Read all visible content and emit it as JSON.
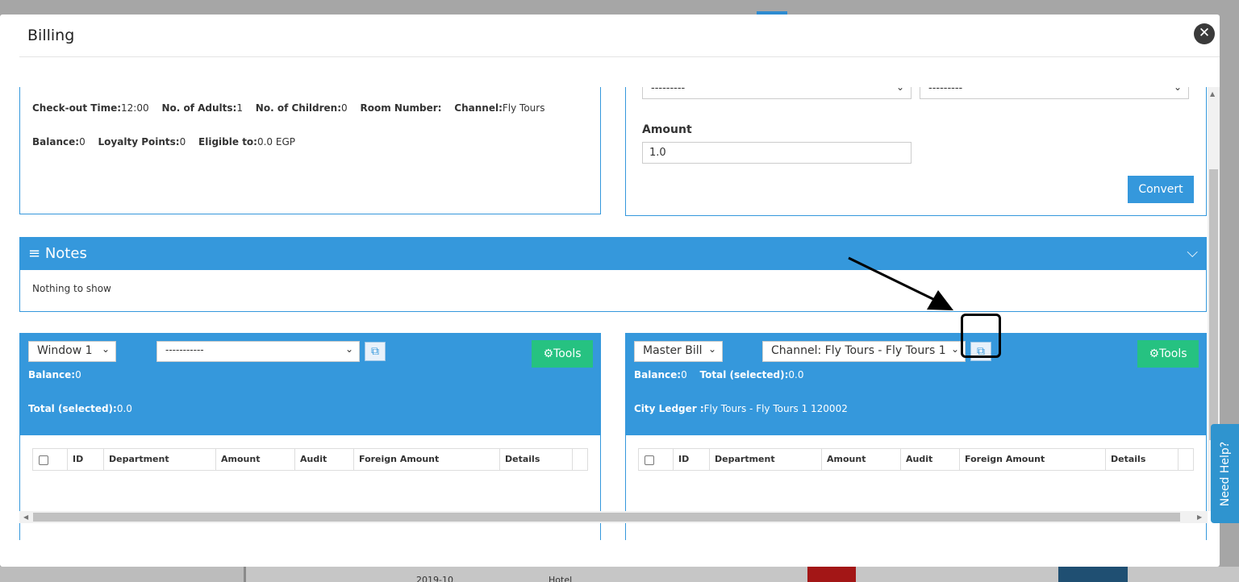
{
  "modal": {
    "title": "Billing"
  },
  "info": {
    "row1": [
      {
        "label": "Check-out Time:",
        "value": "12:00"
      },
      {
        "label": "No. of Adults:",
        "value": "1"
      },
      {
        "label": "No. of Children:",
        "value": "0"
      },
      {
        "label": "Room Number:",
        "value": ""
      },
      {
        "label": "Channel:",
        "value": "Fly Tours"
      }
    ],
    "row2": [
      {
        "label": "Balance:",
        "value": "0"
      },
      {
        "label": "Loyalty Points:",
        "value": "0"
      },
      {
        "label": "Eligible to:",
        "value": "0.0 EGP"
      }
    ]
  },
  "convert": {
    "select1": "---------",
    "select2": "---------",
    "amount_label": "Amount",
    "amount_value": "1.0",
    "button": "Convert"
  },
  "notes": {
    "title": "Notes",
    "body": "Nothing to show"
  },
  "window_left": {
    "window_select": "Window 1",
    "target_select": "-----------",
    "tools": "Tools",
    "balance_label": "Balance:",
    "balance_value": "0",
    "total_label": "Total (selected):",
    "total_value": "0.0"
  },
  "window_right": {
    "window_select": "Master Bill",
    "target_select": "Channel: Fly Tours - Fly Tours 1",
    "tools": "Tools",
    "balance_label": "Balance:",
    "balance_value": "0",
    "total_label": "Total (selected):",
    "total_value": "0.0",
    "ledger_label": "City Ledger :",
    "ledger_value": "Fly Tours - Fly Tours 1 120002"
  },
  "table_columns": [
    "ID",
    "Department",
    "Amount",
    "Audit",
    "Foreign Amount",
    "Details"
  ],
  "need_help": "Need Help?",
  "background": {
    "text1": "2019-10",
    "text2": "Hotel"
  }
}
